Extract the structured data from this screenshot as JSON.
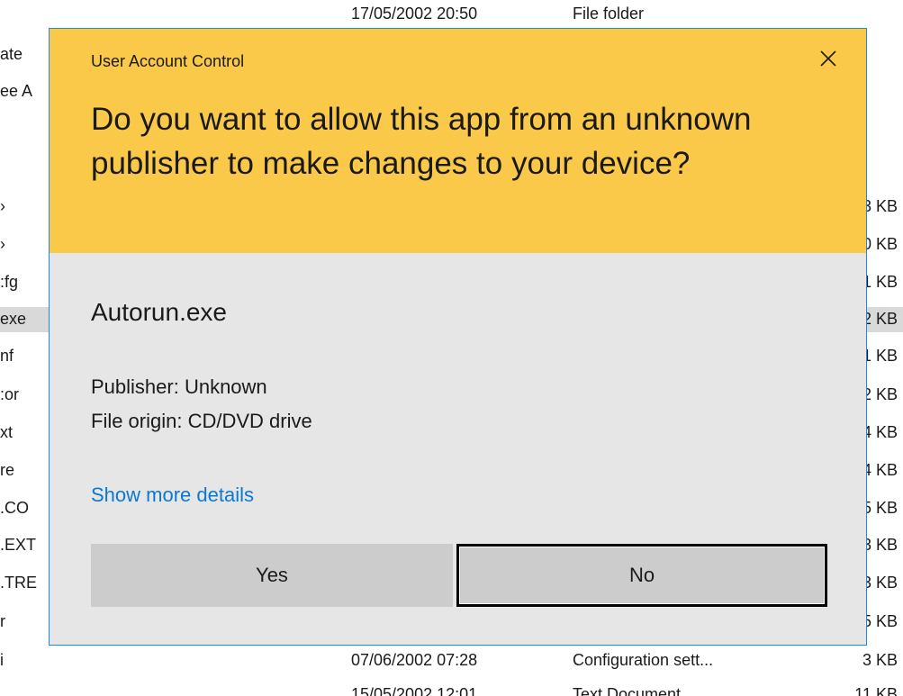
{
  "background": {
    "rows": [
      {
        "name": "",
        "date": "17/05/2002 20:50",
        "type": "File folder",
        "size": ""
      },
      {
        "name": "ate",
        "date": "",
        "type": "",
        "size": ""
      },
      {
        "name": "ee A",
        "date": "",
        "type": "",
        "size": ""
      },
      {
        "name": "",
        "date": "",
        "type": "",
        "size": ""
      },
      {
        "name": "",
        "date": "",
        "type": "",
        "size": ""
      },
      {
        "name": "›",
        "date": "",
        "type": "",
        "size": "3 KB"
      },
      {
        "name": "›",
        "date": "",
        "type": "",
        "size": "0 KB"
      },
      {
        "name": ":fg",
        "date": "",
        "type": "",
        "size": "1 KB"
      },
      {
        "name": "exe",
        "date": "",
        "type": "",
        "size": "2 KB"
      },
      {
        "name": "nf",
        "date": "",
        "type": "",
        "size": "1 KB"
      },
      {
        "name": ":or",
        "date": "",
        "type": "",
        "size": "2 KB"
      },
      {
        "name": "xt",
        "date": "",
        "type": "",
        "size": "4 KB"
      },
      {
        "name": "re",
        "date": "",
        "type": "",
        "size": "4 KB"
      },
      {
        "name": ".CO",
        "date": "",
        "type": "",
        "size": "5 KB"
      },
      {
        "name": ".EXT",
        "date": "",
        "type": "",
        "size": "3 KB"
      },
      {
        "name": ".TRE",
        "date": "",
        "type": "",
        "size": "3 KB"
      },
      {
        "name": "r",
        "date": "",
        "type": "",
        "size": "5 KB"
      },
      {
        "name": "i",
        "date": "07/06/2002 07:28",
        "type": "Configuration sett...",
        "size": "3 KB"
      },
      {
        "name": "",
        "date": "15/05/2002 12:01",
        "type": "Text Document",
        "size": "11 KB"
      }
    ],
    "selected_row": 8
  },
  "dialog": {
    "title": "User Account Control",
    "close_icon": "close-icon",
    "question": "Do you want to allow this app from an unknown publisher to make changes to your device?",
    "app_name": "Autorun.exe",
    "publisher": "Publisher: Unknown",
    "file_origin": "File origin: CD/DVD drive",
    "more_details": "Show more details",
    "yes_label": "Yes",
    "no_label": "No",
    "colors": {
      "header": "#fac94a",
      "body": "#e6e6e6",
      "border": "#1e88e5",
      "link": "#0a78d7",
      "button": "#cccccc"
    }
  }
}
